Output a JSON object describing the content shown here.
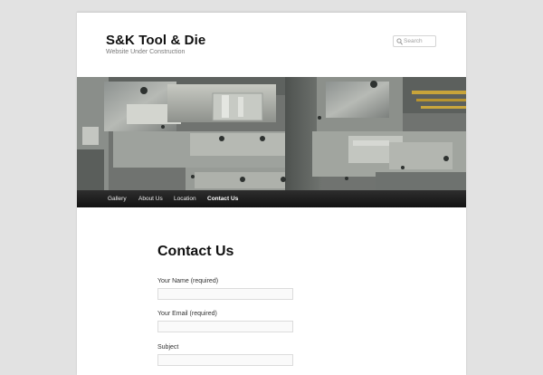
{
  "site": {
    "title": "S&K Tool & Die",
    "description": "Website Under Construction"
  },
  "search": {
    "placeholder": "Search",
    "icon": "search-icon"
  },
  "banner": {
    "icon": "header-banner-image"
  },
  "nav": {
    "items": [
      {
        "label": "Gallery"
      },
      {
        "label": "About Us"
      },
      {
        "label": "Location"
      },
      {
        "label": "Contact Us"
      }
    ],
    "active": "Contact Us"
  },
  "content": {
    "title": "Contact Us",
    "fields": [
      {
        "label": "Your Name (required)",
        "value": ""
      },
      {
        "label": "Your Email (required)",
        "value": ""
      },
      {
        "label": "Subject",
        "value": ""
      }
    ]
  },
  "colors": {
    "background": "#e2e2e2",
    "page": "#ffffff",
    "nav": "#1e1e1e",
    "text": "#111111"
  }
}
